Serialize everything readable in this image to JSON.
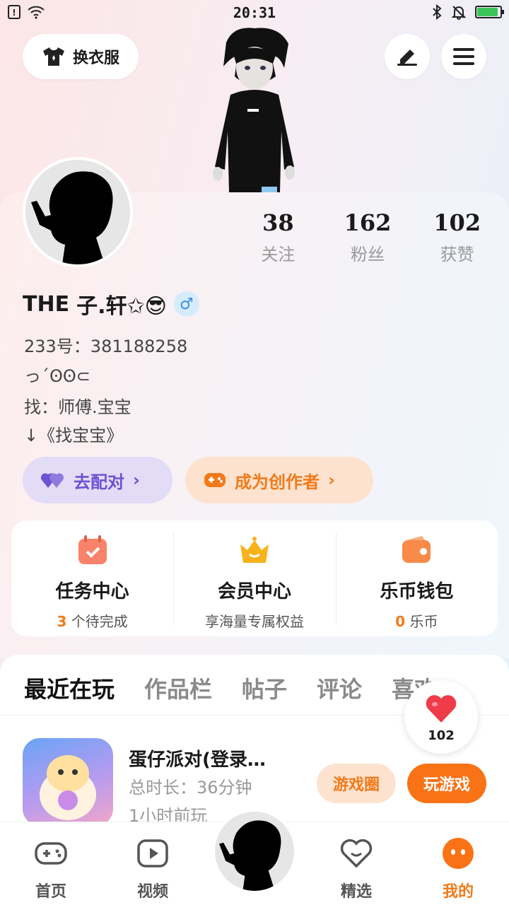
{
  "status_bar": {
    "time": "20:31",
    "battery_percent": 90
  },
  "header": {
    "wardrobe_label": "换衣服",
    "edit_icon": "pen-icon",
    "menu_icon": "menu-icon"
  },
  "profile": {
    "following_count": "38",
    "following_label": "关注",
    "followers_count": "162",
    "followers_label": "粉丝",
    "likes_count": "102",
    "likes_label": "获赞",
    "name_prefix": "THE",
    "name": "子.轩✩😎",
    "gender_symbol": "♂",
    "id_line": "233号：381188258",
    "bio_line1": "っ΄ꙨꙨ⊂",
    "bio_line2": "找：师傅.宝宝",
    "bio_line3": "↓《找宝宝》"
  },
  "actions": {
    "pair_label": "去配对",
    "creator_label": "成为创作者"
  },
  "quick_links": [
    {
      "title": "任务中心",
      "sub_highlight": "3",
      "sub": " 个待完成"
    },
    {
      "title": "会员中心",
      "sub_highlight": "",
      "sub": "享海量专属权益"
    },
    {
      "title": "乐币钱包",
      "sub_highlight": "0",
      "sub": " 乐币"
    }
  ],
  "tabs": [
    "最近在玩",
    "作品栏",
    "帖子",
    "评论",
    "喜欢"
  ],
  "game": {
    "title": "蛋仔派对(登录…",
    "duration": "总时长：36分钟",
    "last_played": "1小时前玩",
    "circle_label": "游戏圈",
    "play_label": "玩游戏"
  },
  "like_fab": {
    "count": "102"
  },
  "bottom_nav": [
    {
      "label": "首页"
    },
    {
      "label": "视频"
    },
    {
      "label": "精选"
    },
    {
      "label": "我的"
    }
  ],
  "colors": {
    "accent": "#f97316",
    "purple": "#6b53d1",
    "gender": "#3b8fe0"
  }
}
